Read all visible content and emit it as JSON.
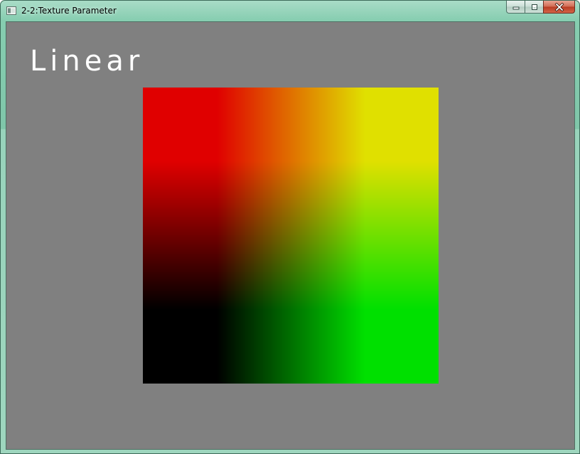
{
  "window": {
    "title": "2-2:Texture Parameter",
    "buttons": [
      "minimize",
      "maximize",
      "close"
    ]
  },
  "icons": {
    "app": "application-window-icon",
    "minimize": "minimize-icon",
    "maximize": "maximize-icon",
    "close": "close-icon"
  },
  "canvas": {
    "label": "Linear",
    "background": "#808080",
    "filter_mode": "Linear",
    "texture_colors": {
      "top_left": "#e00000",
      "top_right": "#e0e000",
      "bottom_left": "#000000",
      "bottom_right": "#00e000"
    }
  }
}
